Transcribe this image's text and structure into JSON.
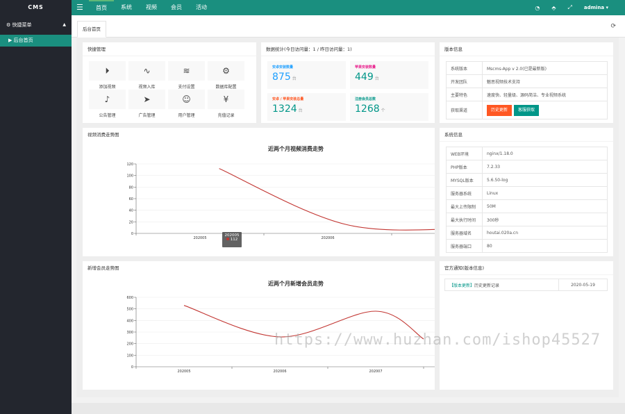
{
  "app": {
    "logo": "CMS",
    "menu_icon": "menu-icon"
  },
  "topnav": [
    {
      "label": "首页",
      "active": true
    },
    {
      "label": "系统",
      "active": false
    },
    {
      "label": "视频",
      "active": false
    },
    {
      "label": "会员",
      "active": false
    },
    {
      "label": "活动",
      "active": false
    }
  ],
  "topright": {
    "icons": [
      "message-icon",
      "tag-icon",
      "fullscreen-icon"
    ],
    "user": "admina ▾"
  },
  "sidebar": {
    "head": "⚙ 快捷菜单",
    "head_caret": "▲",
    "items": [
      {
        "label": "▶ 后台首页"
      }
    ]
  },
  "tabs": [
    {
      "label": "后台首页"
    }
  ],
  "quick": {
    "title": "快捷管理",
    "items": [
      {
        "label": "添加视频",
        "icon": "play-icon",
        "glyph": "⏵"
      },
      {
        "label": "视频入库",
        "icon": "pulse-icon",
        "glyph": "∿"
      },
      {
        "label": "支付设置",
        "icon": "layers-icon",
        "glyph": "≋"
      },
      {
        "label": "数据库配置",
        "icon": "gear-icon",
        "glyph": "⚙"
      },
      {
        "label": "公告管理",
        "icon": "speaker-icon",
        "glyph": "♪"
      },
      {
        "label": "广告管理",
        "icon": "send-icon",
        "glyph": "➤"
      },
      {
        "label": "用户管理",
        "icon": "user-icon",
        "glyph": "☺"
      },
      {
        "label": "充值记录",
        "icon": "yen-icon",
        "glyph": "¥"
      }
    ]
  },
  "stats": {
    "title": "数据统计(今日访问量：1 / 昨日访问量：1)",
    "items": [
      {
        "label": "安卓安装数量",
        "value": "875",
        "unit": "台",
        "label_color": "#1e9fff",
        "value_color": "#1e9fff"
      },
      {
        "label": "苹果安装数量",
        "value": "449",
        "unit": "台",
        "label_color": "#e91e8c",
        "value_color": "#009688"
      },
      {
        "label": "安卓 / 苹果安装总量",
        "value": "1324",
        "unit": "台",
        "label_color": "#ff5722",
        "value_color": "#009688"
      },
      {
        "label": "注册会员总数",
        "value": "1268",
        "unit": "个",
        "label_color": "#009688",
        "value_color": "#009688"
      }
    ]
  },
  "version": {
    "title": "版本信息",
    "rows": [
      {
        "k": "系统版本",
        "v": "Mscms-App v 2.0(已是最新版)"
      },
      {
        "k": "开发团队",
        "v": "魅思视频技术支持"
      },
      {
        "k": "主要特色",
        "v": "速度快、轻量级、源码简洁、专业视频系统"
      }
    ],
    "channel_key": "获取渠道",
    "btn_history": "历史更新",
    "btn_support": "客服获取"
  },
  "sysinfo": {
    "title": "系统信息",
    "rows": [
      {
        "k": "WEB环境",
        "v": "nginx/1.18.0"
      },
      {
        "k": "PHP版本",
        "v": "7.2.33"
      },
      {
        "k": "MYSQL版本",
        "v": "5.6.50-log"
      },
      {
        "k": "服务器系统",
        "v": "Linux"
      },
      {
        "k": "最大上传限制",
        "v": "50M"
      },
      {
        "k": "最大执行时间",
        "v": "300秒"
      },
      {
        "k": "服务器域名",
        "v": "houtai.020a.cn"
      },
      {
        "k": "服务器端口",
        "v": "80"
      }
    ]
  },
  "notice": {
    "title": "官方通知(版本信息)",
    "tag": "【版本更新】",
    "text": "历史更新记录",
    "date": "2020-05-19"
  },
  "chart1_panel": {
    "title": "视频消费走势图"
  },
  "chart2_panel": {
    "title": "新增会员走势图"
  },
  "tooltip": {
    "period": "202005",
    "value": "112"
  },
  "watermark": "https://www.huzhan.com/ishop45527",
  "chart_data": [
    {
      "type": "line",
      "title": "近两个月视频消费走势",
      "categories": [
        "202005",
        "202006"
      ],
      "x": [
        0.65,
        1.65,
        2.65
      ],
      "values": [
        112,
        15,
        9
      ],
      "ylim": [
        0,
        120
      ],
      "yticks": [
        0,
        20,
        40,
        60,
        80,
        100,
        120
      ],
      "color": "#c23531"
    },
    {
      "type": "line",
      "title": "近两个月新增会员走势",
      "categories": [
        "202005",
        "202006",
        "202007"
      ],
      "x": [
        0.5,
        1.5,
        2.5,
        3.0
      ],
      "values": [
        530,
        258,
        480,
        240
      ],
      "ylim": [
        0,
        600
      ],
      "yticks": [
        0,
        100,
        200,
        300,
        400,
        500,
        600
      ],
      "color": "#c23531"
    }
  ]
}
